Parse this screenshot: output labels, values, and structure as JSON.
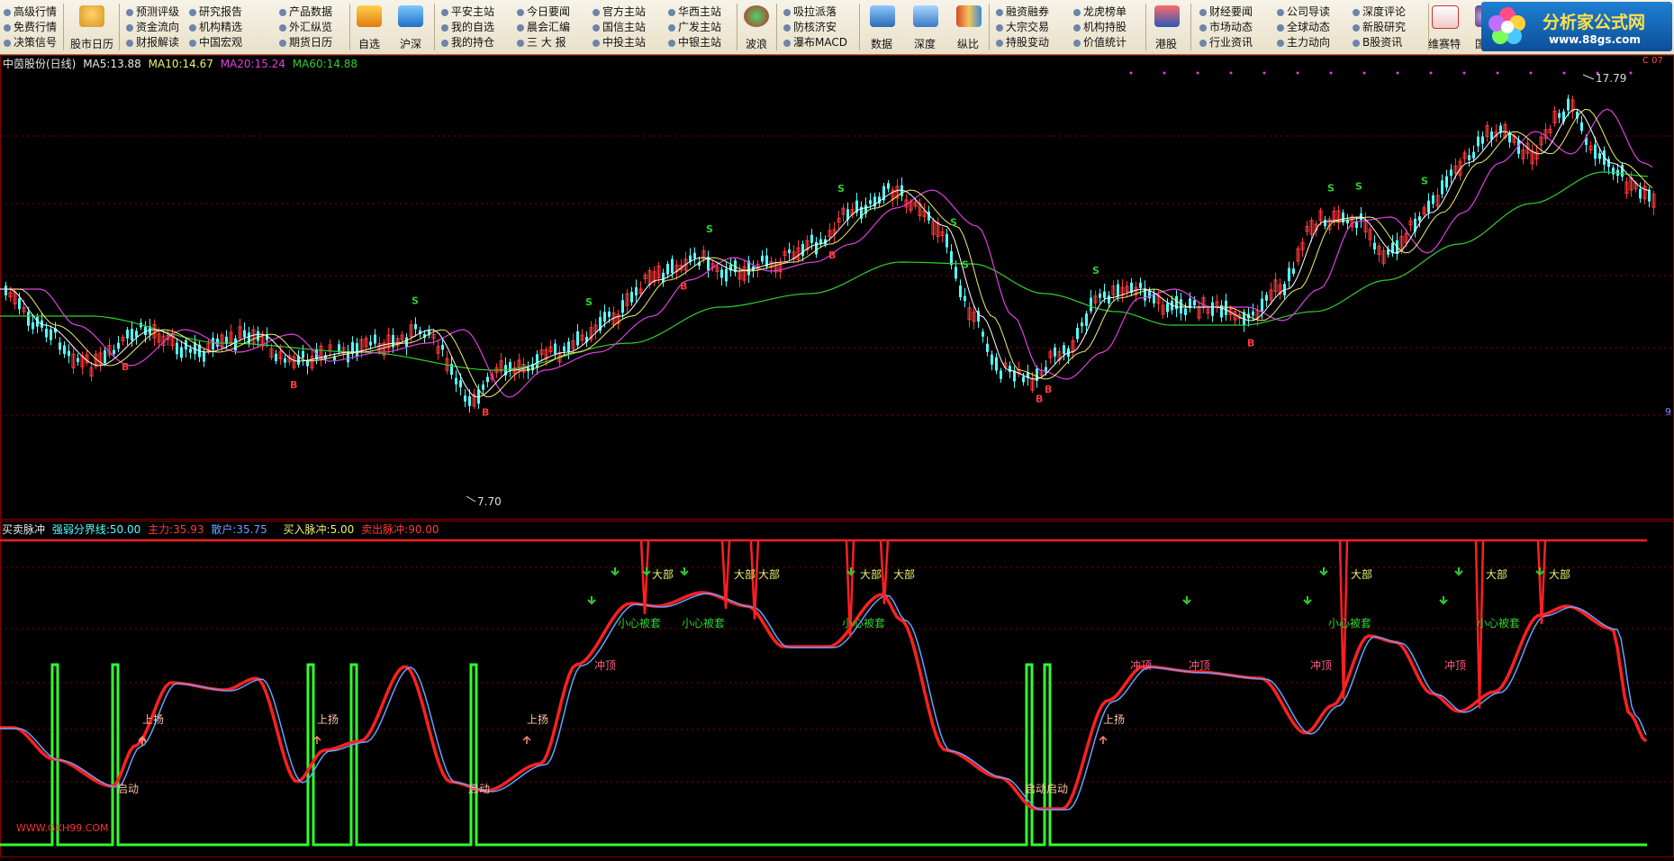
{
  "toolbar": {
    "col1": [
      "高级行情",
      "免费行情",
      "决策信号"
    ],
    "big1": "股市日历",
    "col2": [
      "预测评级",
      "资金流向",
      "财报解读"
    ],
    "col3": [
      "研究报告",
      "机构精选",
      "中国宏观"
    ],
    "col4": [
      "产品数据",
      "外汇纵览",
      "期货日历"
    ],
    "big2": "自选",
    "big3": "沪深",
    "col5": [
      "平安主站",
      "我的自选",
      "我的持仓"
    ],
    "col6": [
      "今日要闻",
      "晨会汇编",
      "三 大 报"
    ],
    "col7": [
      "官方主站",
      "国信主站",
      "中投主站"
    ],
    "col8": [
      "华西主站",
      "广发主站",
      "中银主站"
    ],
    "big4": "波浪",
    "col9": [
      "吸拉派落",
      "防核济安",
      "瀑布MACD"
    ],
    "big5": "数据",
    "big6": "深度",
    "big7": "纵比",
    "col10": [
      "融资融券",
      "大宗交易",
      "持股变动"
    ],
    "col11": [
      "龙虎榜单",
      "机构持股",
      "价值统计"
    ],
    "big8": "港股",
    "col12": [
      "财经要闻",
      "市场动态",
      "行业资讯"
    ],
    "col13": [
      "公司导读",
      "全球动态",
      "主力动向"
    ],
    "col14": [
      "深度评论",
      "新股研究",
      "B股资讯"
    ],
    "big9": "维赛特",
    "big10": "国",
    "logo_text": "分析家公式网",
    "logo_url": "www.88gs.com"
  },
  "main_panel": {
    "stock": "中茵股份(日线)",
    "ma5_label": "MA5:",
    "ma5": "13.88",
    "ma10_label": "MA10:",
    "ma10": "14.67",
    "ma20_label": "MA20:",
    "ma20": "15.24",
    "ma60_label": "MA60:",
    "ma60": "14.88",
    "high_label": "17.79",
    "low_label": "7.70",
    "right_marker": "9",
    "top_right": "C 07",
    "signal_buy": "B",
    "signal_sell": "S"
  },
  "sub_panel": {
    "name": "买卖脉冲",
    "line1_label": "强弱分界线:",
    "line1": "50.00",
    "line2_label": "主力:",
    "line2": "35.93",
    "line3_label": "散户:",
    "line3": "35.75",
    "line4_label": "买入脉冲:",
    "line4": "5.00",
    "line5_label": "卖出脉冲:",
    "line5": "90.00",
    "watermark": "WWW.GXH99.COM",
    "ann_top": "大部",
    "ann_careful": "小心被套",
    "ann_rush": "冲顶",
    "ann_rise": "上扬",
    "ann_start": "启动",
    "ann_start2": "启动启动"
  },
  "colors": {
    "up": "#ff3a3a",
    "down": "#54ffff",
    "ma5": "#ffffff",
    "ma10": "#f0f070",
    "ma20": "#e040e0",
    "ma60": "#30d030",
    "main_line": "#ff2020",
    "retail_line": "#6aa0ff",
    "pulse": "#30ff30",
    "grid": "#8a0000"
  }
}
